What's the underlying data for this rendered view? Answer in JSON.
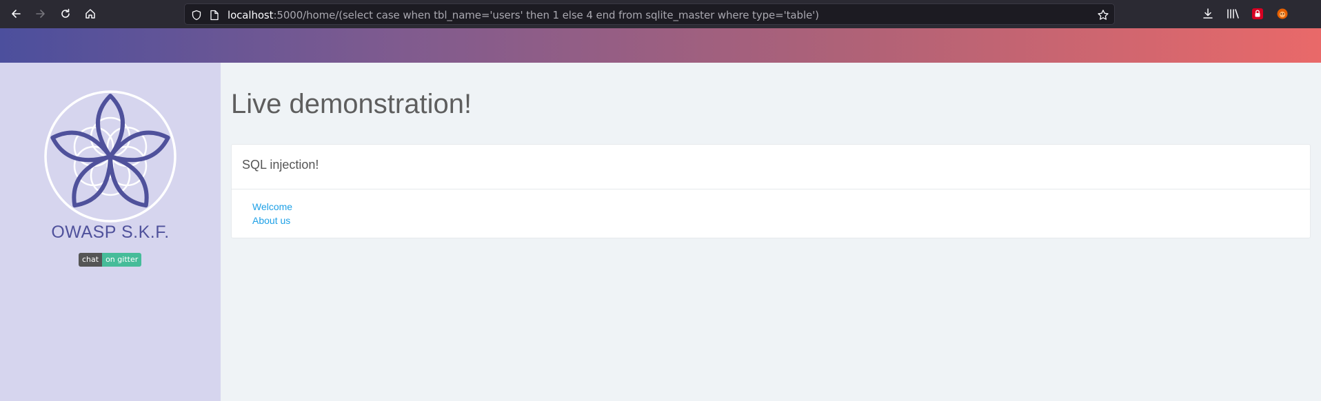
{
  "browser": {
    "url_host": "localhost",
    "url_rest": ":5000/home/(select case when tbl_name='users' then 1 else 4 end from sqlite_master where type='table')"
  },
  "sidebar": {
    "brand": "OWASP S.K.F.",
    "badge": {
      "left": "chat",
      "right": "on gitter"
    }
  },
  "main": {
    "title": "Live demonstration!",
    "card": {
      "header": "SQL injection!",
      "links": [
        "Welcome",
        "About us"
      ]
    }
  },
  "colors": {
    "browser_bg": "#2b2a33",
    "sidebar_bg": "#d6d5ee",
    "main_bg": "#eff3f6",
    "brand": "#4f519b",
    "link": "#1ea0e6",
    "badge_left": "#555555",
    "badge_right": "#46bc99"
  },
  "icons": [
    "back-icon",
    "forward-icon",
    "reload-icon",
    "home-icon",
    "shield-icon",
    "page-icon",
    "bookmark-star-icon",
    "download-icon",
    "library-icon",
    "extension-lock-icon",
    "extension-fox-icon"
  ]
}
